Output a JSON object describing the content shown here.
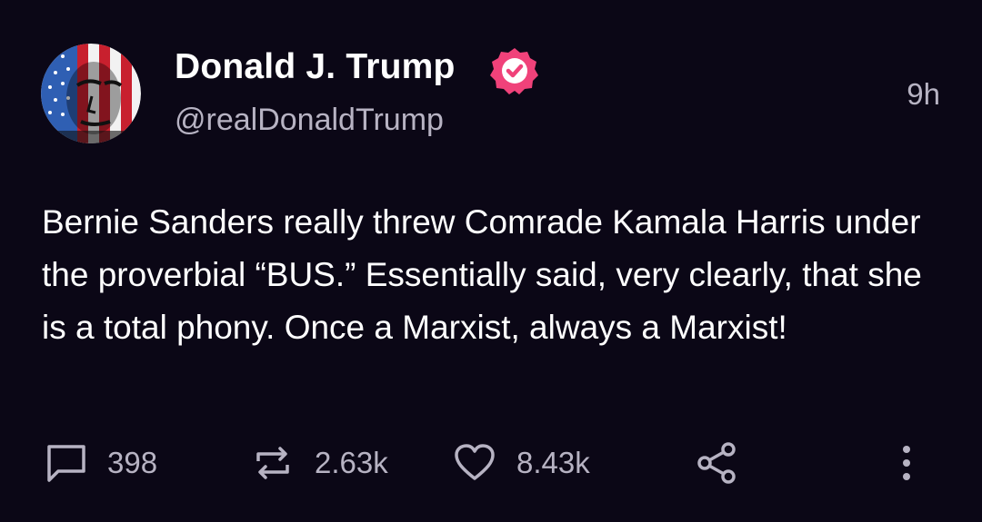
{
  "post": {
    "author": {
      "name": "Donald J. Trump",
      "handle": "@realDonaldTrump",
      "verified": true,
      "verified_color": "#f0427a"
    },
    "timestamp": "9h",
    "text": "Bernie Sanders really threw Comrade Kamala Harris under the proverbial “BUS.” Essentially said, very clearly, that she is a total phony. Once a Marxist, always a Marxist!",
    "actions": {
      "replies": "398",
      "reposts": "2.63k",
      "likes": "8.43k"
    }
  },
  "icons": {
    "reply": "comment-icon",
    "repost": "repost-icon",
    "like": "heart-icon",
    "share": "share-icon",
    "more": "more-vertical-icon"
  },
  "theme": {
    "background": "#0b0716",
    "text_primary": "#ffffff",
    "text_secondary": "#b7b3c3"
  }
}
